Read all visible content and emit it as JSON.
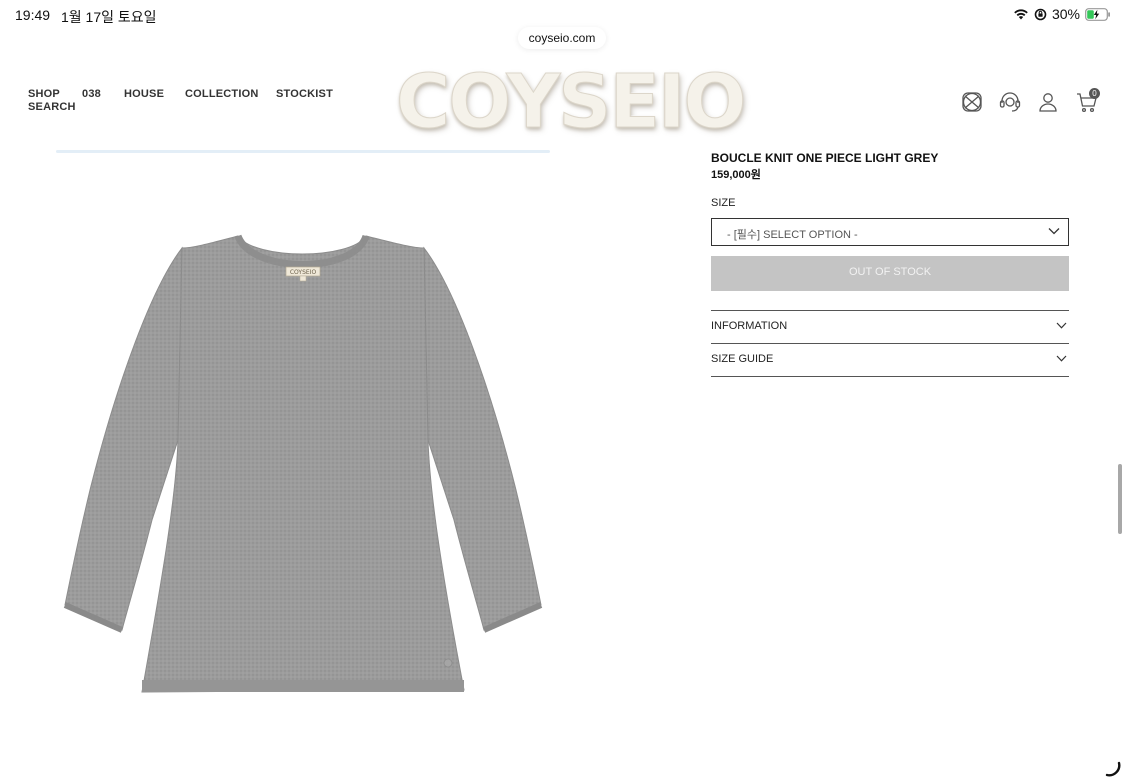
{
  "status_bar": {
    "time": "19:49",
    "date": "1월 17일 토요일",
    "battery": "30%"
  },
  "browser": {
    "url": "coyseio.com"
  },
  "nav": {
    "items": [
      "SHOP",
      "038",
      "HOUSE",
      "COLLECTION",
      "STOCKIST",
      "SEARCH"
    ]
  },
  "brand": {
    "logo_text": "COYSEIO",
    "label_text": "COYSEIO"
  },
  "header_icons": {
    "icons": [
      "globe-icon",
      "headset-icon",
      "user-icon",
      "cart-icon"
    ],
    "cart_count": "0"
  },
  "product": {
    "title": "BOUCLE KNIT ONE PIECE LIGHT GREY",
    "price": "159,000원",
    "size_label": "SIZE",
    "size_select": "- [필수] SELECT OPTION -",
    "stock_button": "OUT OF STOCK",
    "accordions": [
      "INFORMATION",
      "SIZE GUIDE"
    ]
  },
  "colors": {
    "sweater": "#9a9a9a",
    "disabled_button": "#c4c4c4",
    "battery_charging": "#34c759"
  }
}
